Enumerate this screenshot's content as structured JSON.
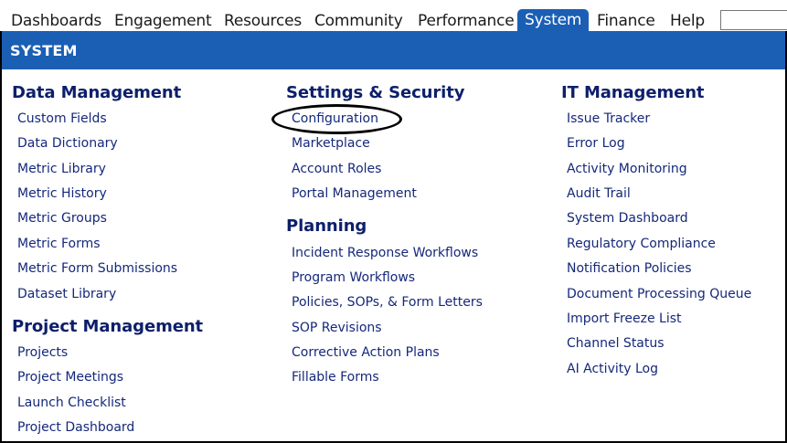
{
  "topnav": {
    "tabs": [
      "Dashboards",
      "Engagement",
      "Resources",
      "Community",
      "Performance",
      "System",
      "Finance",
      "Help"
    ],
    "active_tab": "System",
    "search_placeholder": ""
  },
  "banner": {
    "title": "SYSTEM"
  },
  "sections": {
    "data_management": {
      "title": "Data Management",
      "items": [
        "Custom Fields",
        "Data Dictionary",
        "Metric Library",
        "Metric History",
        "Metric Groups",
        "Metric Forms",
        "Metric Form Submissions",
        "Dataset Library"
      ]
    },
    "project_management": {
      "title": "Project Management",
      "items": [
        "Projects",
        "Project Meetings",
        "Launch Checklist",
        "Project Dashboard"
      ]
    },
    "settings_security": {
      "title": "Settings & Security",
      "items": [
        "Configuration",
        "Marketplace",
        "Account Roles",
        "Portal Management"
      ]
    },
    "planning": {
      "title": "Planning",
      "items": [
        "Incident Response Workflows",
        "Program Workflows",
        "Policies, SOPs, & Form Letters",
        "SOP Revisions",
        "Corrective Action Plans",
        "Fillable Forms"
      ]
    },
    "it_management": {
      "title": "IT Management",
      "items": [
        "Issue Tracker",
        "Error Log",
        "Activity Monitoring",
        "Audit Trail",
        "System Dashboard",
        "Regulatory Compliance",
        "Notification Policies",
        "Document Processing Queue",
        "Import Freeze List",
        "Channel Status",
        "AI Activity Log"
      ]
    }
  },
  "colors": {
    "brand_blue": "#1a5fb4",
    "heading": "#0d1f6b",
    "link": "#14287a"
  }
}
